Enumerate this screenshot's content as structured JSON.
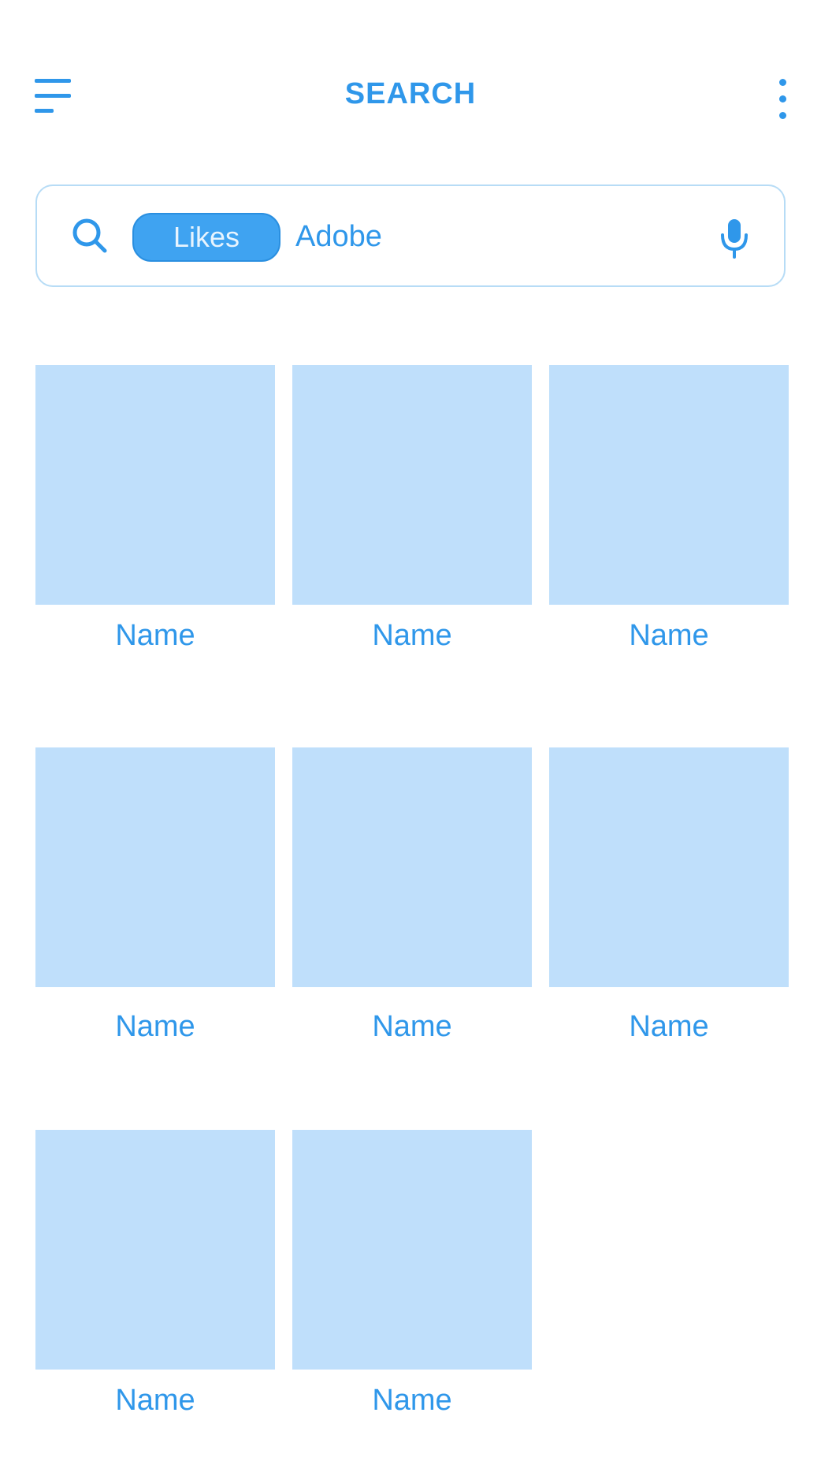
{
  "header": {
    "title": "SEARCH",
    "menu_icon": "menu-icon",
    "more_icon": "more-vertical-icon"
  },
  "search": {
    "icon": "search-icon",
    "chip_label": "Likes",
    "query": "Adobe",
    "mic_icon": "microphone-icon"
  },
  "results": [
    {
      "name": "Name"
    },
    {
      "name": "Name"
    },
    {
      "name": "Name"
    },
    {
      "name": "Name"
    },
    {
      "name": "Name"
    },
    {
      "name": "Name"
    },
    {
      "name": "Name"
    },
    {
      "name": "Name"
    }
  ],
  "colors": {
    "accent": "#2f97ea",
    "tile": "#bfdffb",
    "chip": "#3fa3f1",
    "border": "#b7dcf6"
  }
}
